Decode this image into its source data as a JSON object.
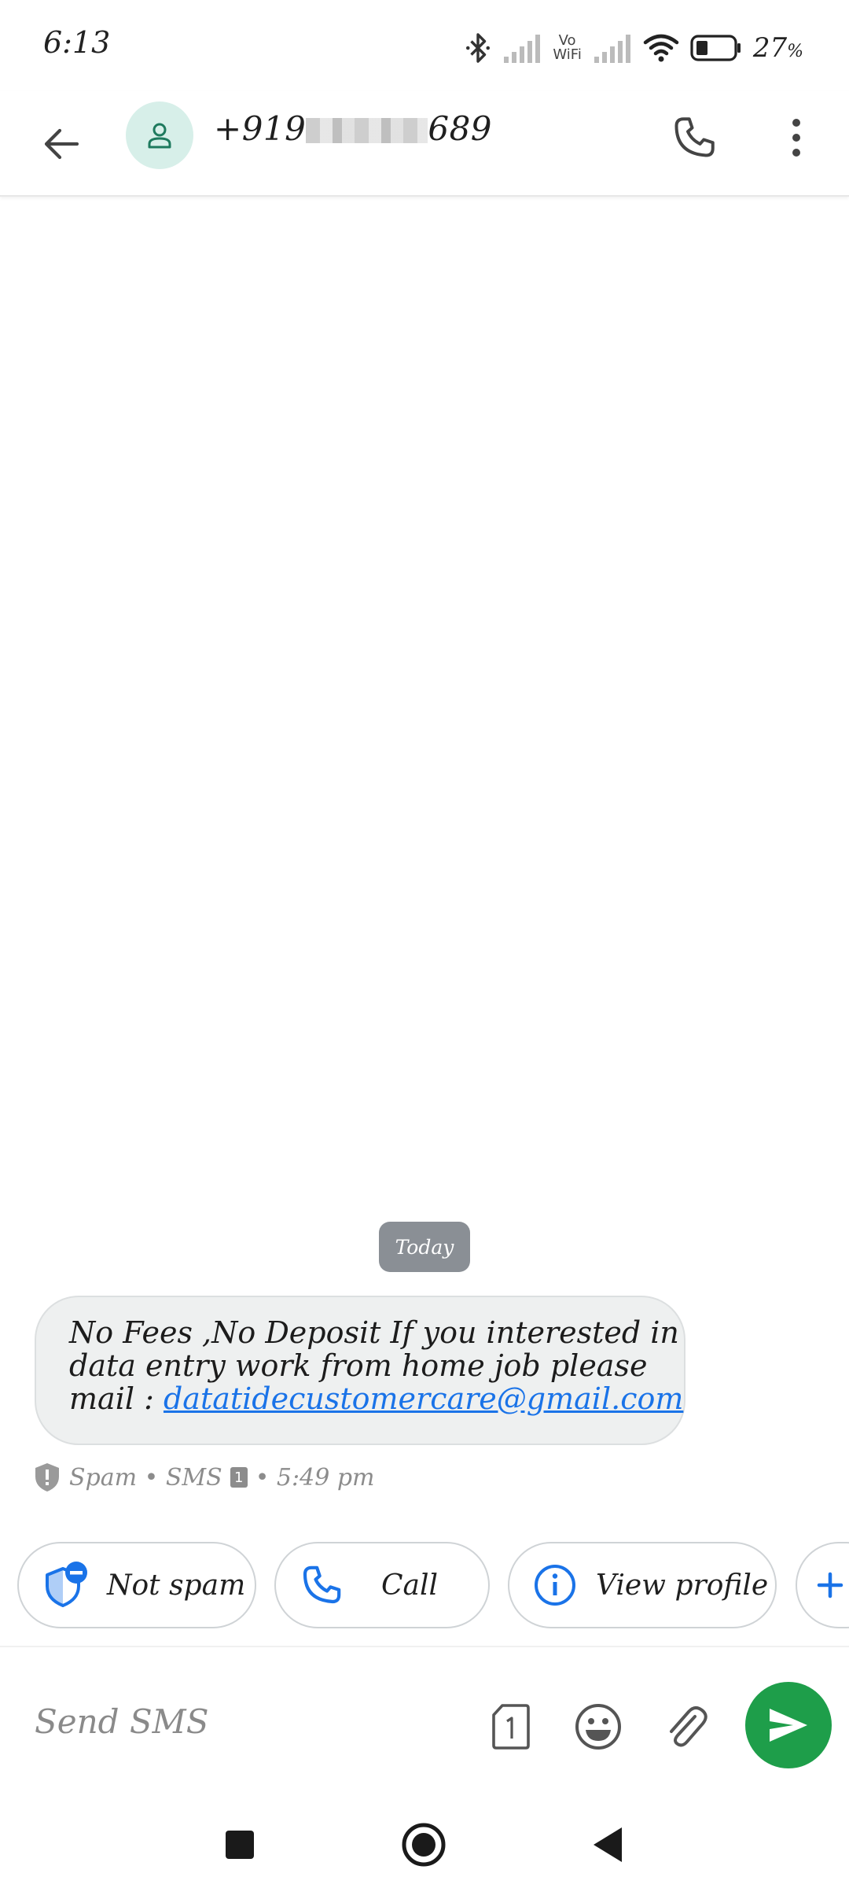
{
  "status_bar": {
    "time": "6:13",
    "vowifi_top": "Vo",
    "vowifi_bottom": "WiFi",
    "battery_percent": "27",
    "battery_unit": "%",
    "icons": [
      "bluetooth-icon",
      "signal-icon",
      "vowifi-icon",
      "signal-icon",
      "wifi-icon",
      "battery-icon"
    ]
  },
  "header": {
    "contact_prefix": "+919",
    "contact_suffix": "689",
    "icons": [
      "back-arrow-icon",
      "person-icon",
      "phone-icon",
      "more-vert-icon"
    ]
  },
  "conversation": {
    "date_label": "Today",
    "message": {
      "line1": "No Fees ,No Deposit If you interested in",
      "line2": "data entry work from home job please",
      "line3_prefix": "mail : ",
      "email_link": "datatidecustomercare@gmail.com"
    },
    "meta": {
      "label": "Spam • SMS",
      "sim": "1",
      "time": "• 5:49 pm"
    }
  },
  "suggestions": [
    {
      "label": "Not spam",
      "icon": "shield-minus-icon"
    },
    {
      "label": "Call",
      "icon": "phone-icon"
    },
    {
      "label": "View profile",
      "icon": "info-icon"
    },
    {
      "label": "",
      "icon": "add-icon"
    }
  ],
  "compose": {
    "placeholder": "Send SMS",
    "sim": "1",
    "icons": [
      "sim-icon",
      "emoji-icon",
      "attach-icon",
      "send-icon"
    ]
  },
  "colors": {
    "accent_blue": "#1a73e8",
    "send_green": "#1e9e4a",
    "avatar_bg": "#d7efe9",
    "bubble_bg": "#eef0f0",
    "date_chip": "#8a8f95"
  }
}
